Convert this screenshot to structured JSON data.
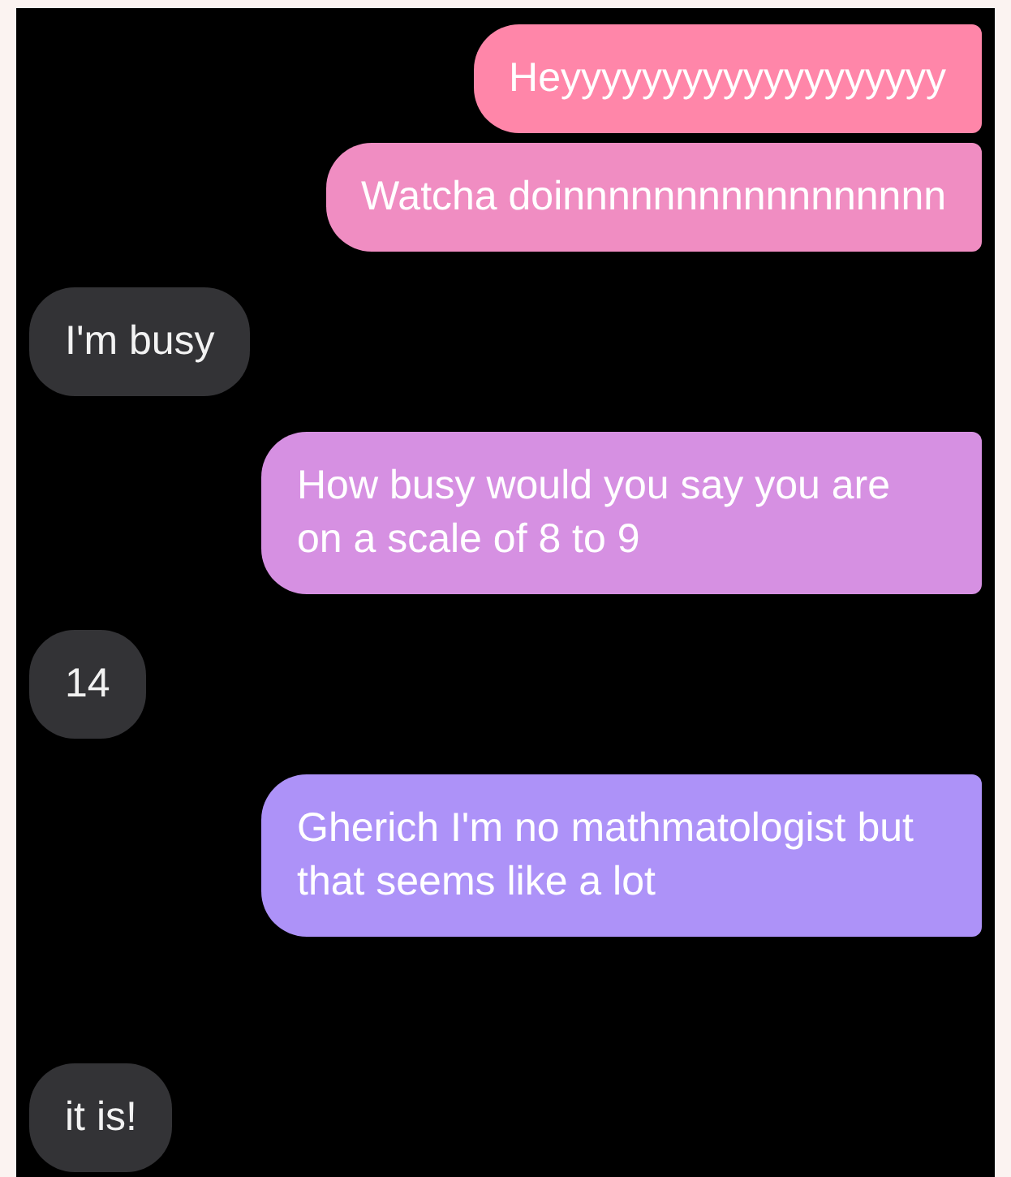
{
  "messages": [
    {
      "kind": "sent",
      "text": "Heyyyyyyyyyyyyyyyyyyy",
      "color": "#ff86a9"
    },
    {
      "kind": "sent",
      "text": "Watcha doinnnnnnnnnnnnnnnnn",
      "color": "#f08dc2"
    },
    {
      "kind": "received",
      "text": "I'm busy"
    },
    {
      "kind": "sent",
      "text": "How busy would you say you are on a scale of 8 to 9",
      "color": "#d690e2"
    },
    {
      "kind": "received",
      "text": "14"
    },
    {
      "kind": "sent",
      "text": "Gherich I'm no mathmatologist but that seems like a lot",
      "color": "#ad92f8"
    },
    {
      "kind": "received",
      "text": "it is!"
    }
  ]
}
